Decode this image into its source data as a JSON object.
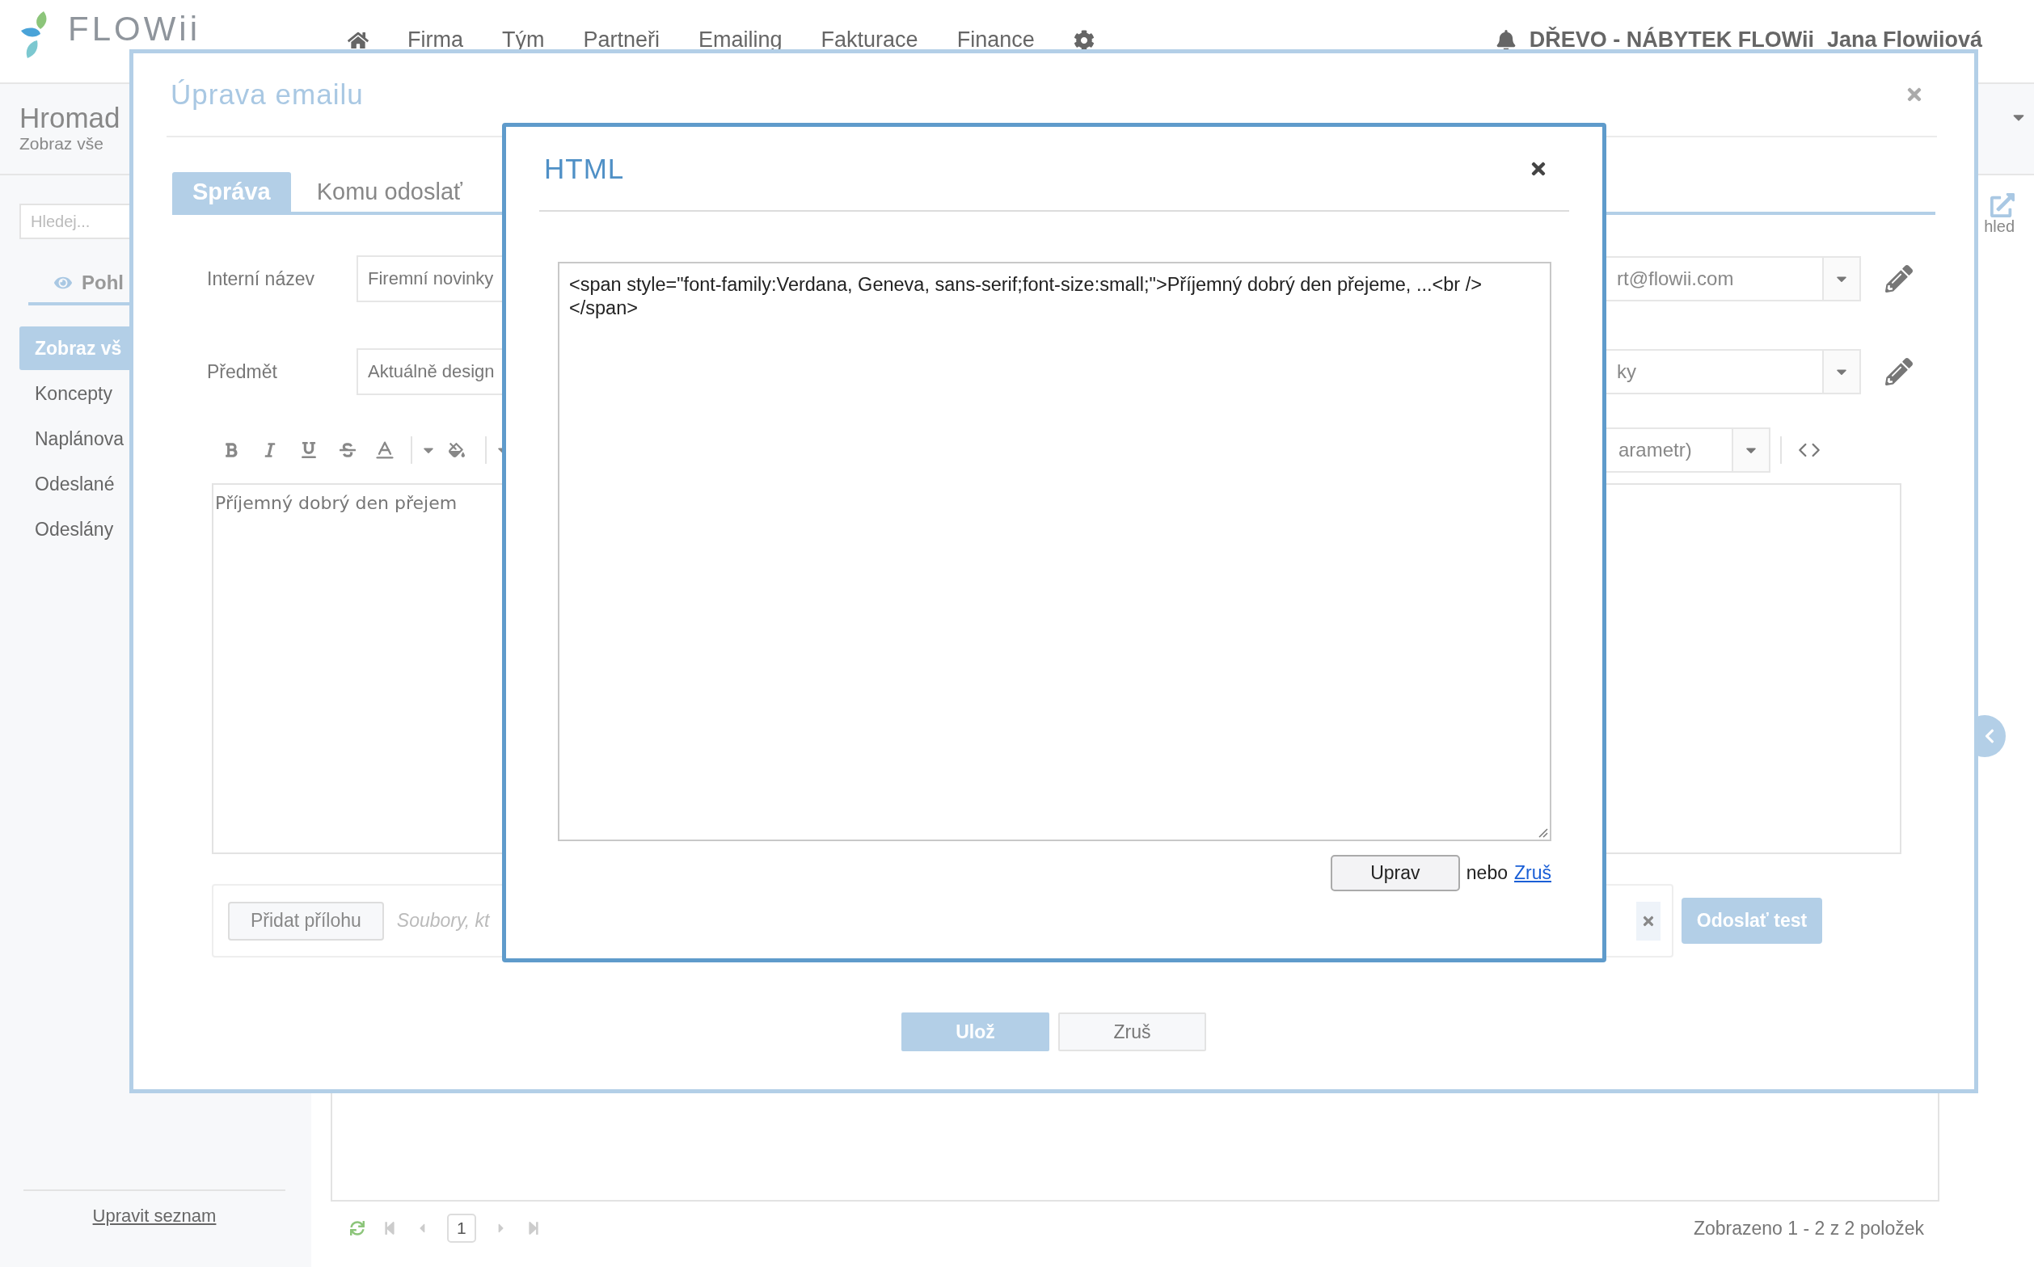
{
  "top_bar": {
    "logo": "FLOWii",
    "nav": [
      "Firma",
      "Tým",
      "Partneři",
      "Emailing",
      "Fakturace",
      "Finance"
    ],
    "company": "DŘEVO - NÁBYTEK FLOWii",
    "user": "Jana Flowiiová"
  },
  "page": {
    "title": "Hromad",
    "subtitle": "Zobraz vše",
    "search": {
      "placeholder": "Hledej..."
    },
    "view_tab": "Pohl",
    "views": [
      {
        "label": "Zobraz vš",
        "selected": true
      },
      {
        "label": "Koncepty",
        "selected": false
      },
      {
        "label": "Naplánova",
        "selected": false
      },
      {
        "label": "Odeslané",
        "selected": false
      },
      {
        "label": "Odeslány",
        "selected": false
      }
    ],
    "edit_list_link": "Upravit seznam",
    "preview_label": "hled",
    "current_page": "1",
    "summary": "Zobrazeno 1 - 2 z 2 položek"
  },
  "email_dialog": {
    "title": "Úprava emailu",
    "tabs": [
      {
        "label": "Správa",
        "selected": true
      },
      {
        "label": "Komu odoslať",
        "selected": false
      }
    ],
    "fields": [
      {
        "label": "Interní název",
        "value": "Firemní novinky",
        "right_value": "rt@flowii.com"
      },
      {
        "label": "Předmět",
        "value": "Aktuálně design",
        "right_value": "ky"
      }
    ],
    "parameter_select": "arametr)",
    "editor_text": "Příjemný dobrý den přejem",
    "attach_button": "Přidat přílohu",
    "attach_placeholder": "Soubory, kt",
    "test_button": "Odoslať test",
    "save_button": "Ulož",
    "cancel_button": "Zruš"
  },
  "html_dialog": {
    "title": "HTML",
    "code": "<span style=\"font-family:Verdana, Geneva, sans-serif;font-size:small;\">Příjemný dobrý den přejeme, ...<br /> </span>",
    "apply_button": "Uprav",
    "or_text": "nebo",
    "cancel_link": "Zruš"
  }
}
